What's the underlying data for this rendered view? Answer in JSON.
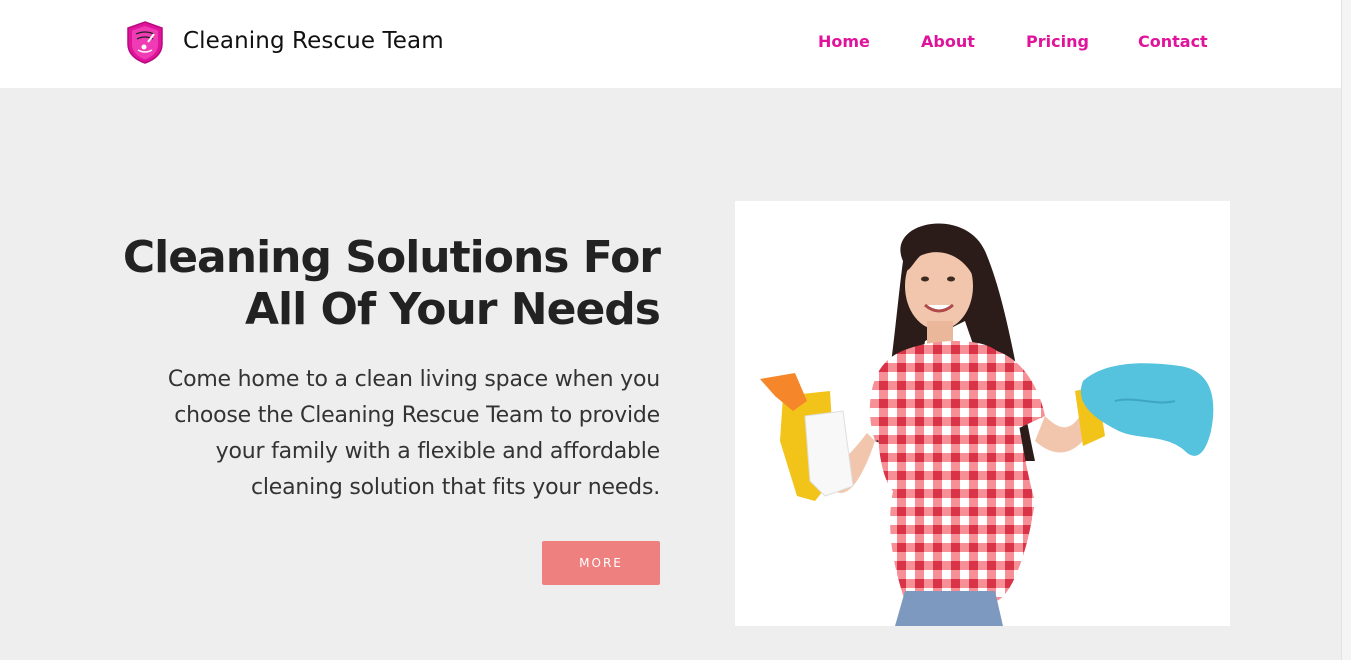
{
  "brand": {
    "name": "Cleaning Rescue Team",
    "logo_icon": "shield-logo-icon",
    "logo_color": "#e0139b"
  },
  "nav": {
    "items": [
      {
        "label": "Home"
      },
      {
        "label": "About"
      },
      {
        "label": "Pricing"
      },
      {
        "label": "Contact"
      }
    ],
    "color": "#e0139b"
  },
  "hero": {
    "headline_line1": "Cleaning Solutions For",
    "headline_line2": "All Of Your Needs",
    "desc_lines": [
      "Come home to a clean living space when you",
      "choose the Cleaning Rescue Team to provide",
      "your family with a flexible and affordable",
      "cleaning solution that fits your needs."
    ],
    "button_label": "MORE",
    "button_color": "#ef8080",
    "image_icon": "woman-with-cleaning-supplies-image"
  }
}
